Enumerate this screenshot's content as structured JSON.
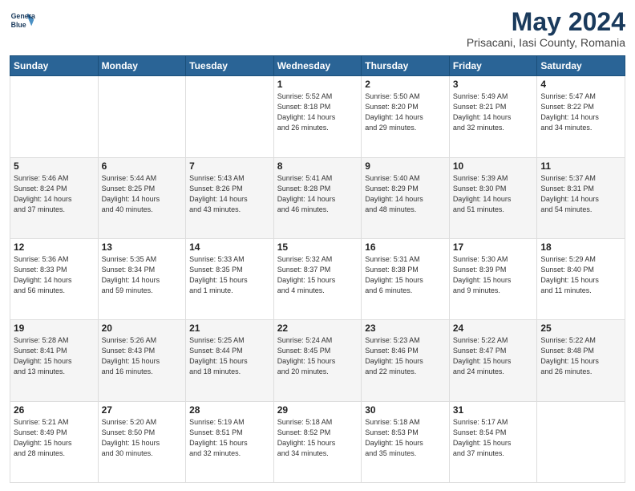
{
  "logo": {
    "line1": "General",
    "line2": "Blue"
  },
  "title": "May 2024",
  "subtitle": "Prisacani, Iasi County, Romania",
  "header_days": [
    "Sunday",
    "Monday",
    "Tuesday",
    "Wednesday",
    "Thursday",
    "Friday",
    "Saturday"
  ],
  "weeks": [
    [
      {
        "day": "",
        "info": ""
      },
      {
        "day": "",
        "info": ""
      },
      {
        "day": "",
        "info": ""
      },
      {
        "day": "1",
        "info": "Sunrise: 5:52 AM\nSunset: 8:18 PM\nDaylight: 14 hours\nand 26 minutes."
      },
      {
        "day": "2",
        "info": "Sunrise: 5:50 AM\nSunset: 8:20 PM\nDaylight: 14 hours\nand 29 minutes."
      },
      {
        "day": "3",
        "info": "Sunrise: 5:49 AM\nSunset: 8:21 PM\nDaylight: 14 hours\nand 32 minutes."
      },
      {
        "day": "4",
        "info": "Sunrise: 5:47 AM\nSunset: 8:22 PM\nDaylight: 14 hours\nand 34 minutes."
      }
    ],
    [
      {
        "day": "5",
        "info": "Sunrise: 5:46 AM\nSunset: 8:24 PM\nDaylight: 14 hours\nand 37 minutes."
      },
      {
        "day": "6",
        "info": "Sunrise: 5:44 AM\nSunset: 8:25 PM\nDaylight: 14 hours\nand 40 minutes."
      },
      {
        "day": "7",
        "info": "Sunrise: 5:43 AM\nSunset: 8:26 PM\nDaylight: 14 hours\nand 43 minutes."
      },
      {
        "day": "8",
        "info": "Sunrise: 5:41 AM\nSunset: 8:28 PM\nDaylight: 14 hours\nand 46 minutes."
      },
      {
        "day": "9",
        "info": "Sunrise: 5:40 AM\nSunset: 8:29 PM\nDaylight: 14 hours\nand 48 minutes."
      },
      {
        "day": "10",
        "info": "Sunrise: 5:39 AM\nSunset: 8:30 PM\nDaylight: 14 hours\nand 51 minutes."
      },
      {
        "day": "11",
        "info": "Sunrise: 5:37 AM\nSunset: 8:31 PM\nDaylight: 14 hours\nand 54 minutes."
      }
    ],
    [
      {
        "day": "12",
        "info": "Sunrise: 5:36 AM\nSunset: 8:33 PM\nDaylight: 14 hours\nand 56 minutes."
      },
      {
        "day": "13",
        "info": "Sunrise: 5:35 AM\nSunset: 8:34 PM\nDaylight: 14 hours\nand 59 minutes."
      },
      {
        "day": "14",
        "info": "Sunrise: 5:33 AM\nSunset: 8:35 PM\nDaylight: 15 hours\nand 1 minute."
      },
      {
        "day": "15",
        "info": "Sunrise: 5:32 AM\nSunset: 8:37 PM\nDaylight: 15 hours\nand 4 minutes."
      },
      {
        "day": "16",
        "info": "Sunrise: 5:31 AM\nSunset: 8:38 PM\nDaylight: 15 hours\nand 6 minutes."
      },
      {
        "day": "17",
        "info": "Sunrise: 5:30 AM\nSunset: 8:39 PM\nDaylight: 15 hours\nand 9 minutes."
      },
      {
        "day": "18",
        "info": "Sunrise: 5:29 AM\nSunset: 8:40 PM\nDaylight: 15 hours\nand 11 minutes."
      }
    ],
    [
      {
        "day": "19",
        "info": "Sunrise: 5:28 AM\nSunset: 8:41 PM\nDaylight: 15 hours\nand 13 minutes."
      },
      {
        "day": "20",
        "info": "Sunrise: 5:26 AM\nSunset: 8:43 PM\nDaylight: 15 hours\nand 16 minutes."
      },
      {
        "day": "21",
        "info": "Sunrise: 5:25 AM\nSunset: 8:44 PM\nDaylight: 15 hours\nand 18 minutes."
      },
      {
        "day": "22",
        "info": "Sunrise: 5:24 AM\nSunset: 8:45 PM\nDaylight: 15 hours\nand 20 minutes."
      },
      {
        "day": "23",
        "info": "Sunrise: 5:23 AM\nSunset: 8:46 PM\nDaylight: 15 hours\nand 22 minutes."
      },
      {
        "day": "24",
        "info": "Sunrise: 5:22 AM\nSunset: 8:47 PM\nDaylight: 15 hours\nand 24 minutes."
      },
      {
        "day": "25",
        "info": "Sunrise: 5:22 AM\nSunset: 8:48 PM\nDaylight: 15 hours\nand 26 minutes."
      }
    ],
    [
      {
        "day": "26",
        "info": "Sunrise: 5:21 AM\nSunset: 8:49 PM\nDaylight: 15 hours\nand 28 minutes."
      },
      {
        "day": "27",
        "info": "Sunrise: 5:20 AM\nSunset: 8:50 PM\nDaylight: 15 hours\nand 30 minutes."
      },
      {
        "day": "28",
        "info": "Sunrise: 5:19 AM\nSunset: 8:51 PM\nDaylight: 15 hours\nand 32 minutes."
      },
      {
        "day": "29",
        "info": "Sunrise: 5:18 AM\nSunset: 8:52 PM\nDaylight: 15 hours\nand 34 minutes."
      },
      {
        "day": "30",
        "info": "Sunrise: 5:18 AM\nSunset: 8:53 PM\nDaylight: 15 hours\nand 35 minutes."
      },
      {
        "day": "31",
        "info": "Sunrise: 5:17 AM\nSunset: 8:54 PM\nDaylight: 15 hours\nand 37 minutes."
      },
      {
        "day": "",
        "info": ""
      }
    ]
  ]
}
